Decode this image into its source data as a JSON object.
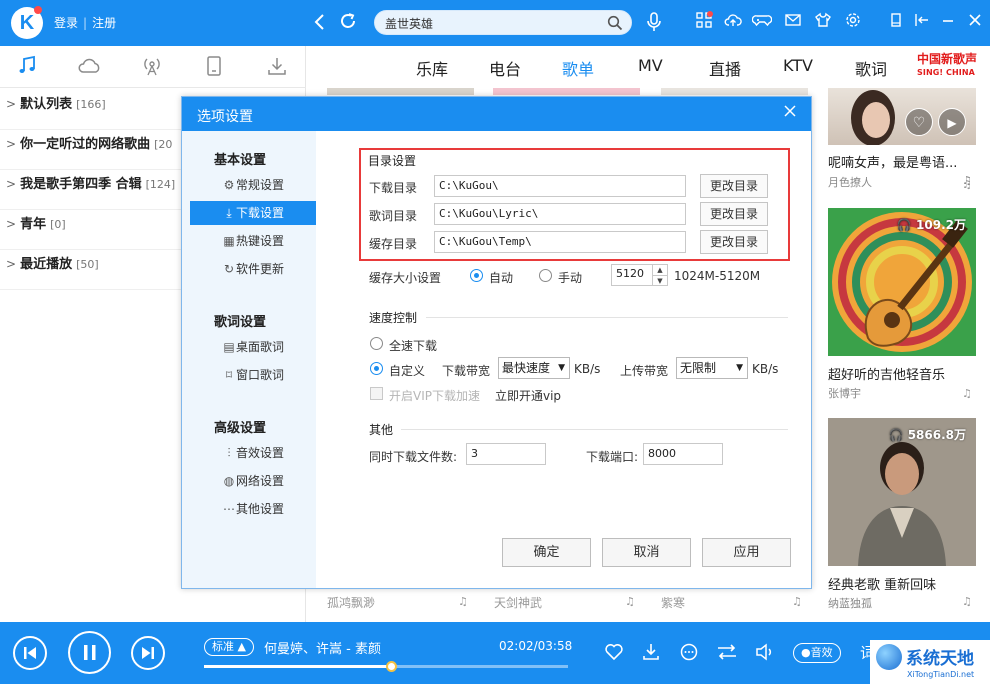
{
  "app": {
    "login": "登录",
    "register": "注册",
    "logo_letter": "K",
    "search_value": "盖世英雄"
  },
  "left_panel": {
    "playlists": [
      {
        "name": "默认列表",
        "count": "[166]"
      },
      {
        "name": "你一定听过的网络歌曲",
        "count": "[20"
      },
      {
        "name": "我是歌手第四季 合辑",
        "count": "[124]"
      },
      {
        "name": "青年",
        "count": "[0]"
      },
      {
        "name": "最近播放",
        "count": "[50]"
      }
    ]
  },
  "catnav": {
    "items": [
      "乐库",
      "电台",
      "歌单",
      "MV",
      "直播",
      "KTV",
      "歌词"
    ],
    "active": "歌单",
    "promo_line1": "中国新歌声",
    "promo_line2": "SING! CHINA"
  },
  "right_column": {
    "items": [
      {
        "title": "呢喃女声，最是粤语...",
        "author": "月色撩人",
        "play_count": ""
      },
      {
        "title": "超好听的吉他轻音乐",
        "author": "张博宇",
        "play_count": "109.2万"
      },
      {
        "title": "经典老歌 重新回味",
        "author": "纳蓝独孤",
        "play_count": "5866.8万"
      }
    ]
  },
  "bottom_row": {
    "items": [
      "孤鸿飘渺",
      "天剑神武",
      "紫寒"
    ]
  },
  "dialog": {
    "title": "选项设置",
    "sidebar": {
      "group_basic": "基本设置",
      "basic_items": [
        "常规设置",
        "下载设置",
        "热键设置",
        "软件更新"
      ],
      "group_lyrics": "歌词设置",
      "lyrics_items": [
        "桌面歌词",
        "窗口歌词"
      ],
      "group_advanced": "高级设置",
      "advanced_items": [
        "音效设置",
        "网络设置",
        "其他设置"
      ]
    },
    "dir_section": {
      "title": "目录设置",
      "rows": [
        {
          "label": "下载目录",
          "path": "C:\\KuGou\\",
          "button": "更改目录"
        },
        {
          "label": "歌词目录",
          "path": "C:\\KuGou\\Lyric\\",
          "button": "更改目录"
        },
        {
          "label": "缓存目录",
          "path": "C:\\KuGou\\Temp\\",
          "button": "更改目录"
        }
      ]
    },
    "cache": {
      "label": "缓存大小设置",
      "auto": "自动",
      "manual": "手动",
      "value": "5120",
      "range": "1024M-5120M"
    },
    "speed": {
      "title": "速度控制",
      "full_speed": "全速下载",
      "custom": "自定义",
      "download_bw_label": "下载带宽",
      "download_bw_value": "最快速度",
      "kbs": "KB/s",
      "upload_bw_label": "上传带宽",
      "upload_bw_value": "无限制",
      "vip_accel": "开启VIP下载加速",
      "vip_link": "立即开通vip"
    },
    "other": {
      "title": "其他",
      "concurrent_label": "同时下载文件数:",
      "concurrent_value": "3",
      "port_label": "下载端口:",
      "port_value": "8000"
    },
    "buttons": {
      "ok": "确定",
      "cancel": "取消",
      "apply": "应用"
    }
  },
  "player": {
    "quality": "标准",
    "song": "何曼婷、许嵩 - 素颜",
    "time": "02:02/03:58",
    "progress": 0.513,
    "effect": "音效",
    "lyric": "词"
  },
  "watermark": {
    "title": "系统天地",
    "url": "XiTongTianDi.net"
  },
  "colors": {
    "accent": "#1a8df0",
    "highlight_border": "#e83a3a",
    "sidebar_bg": "#eef6fd",
    "promo": "#e21d1d"
  }
}
